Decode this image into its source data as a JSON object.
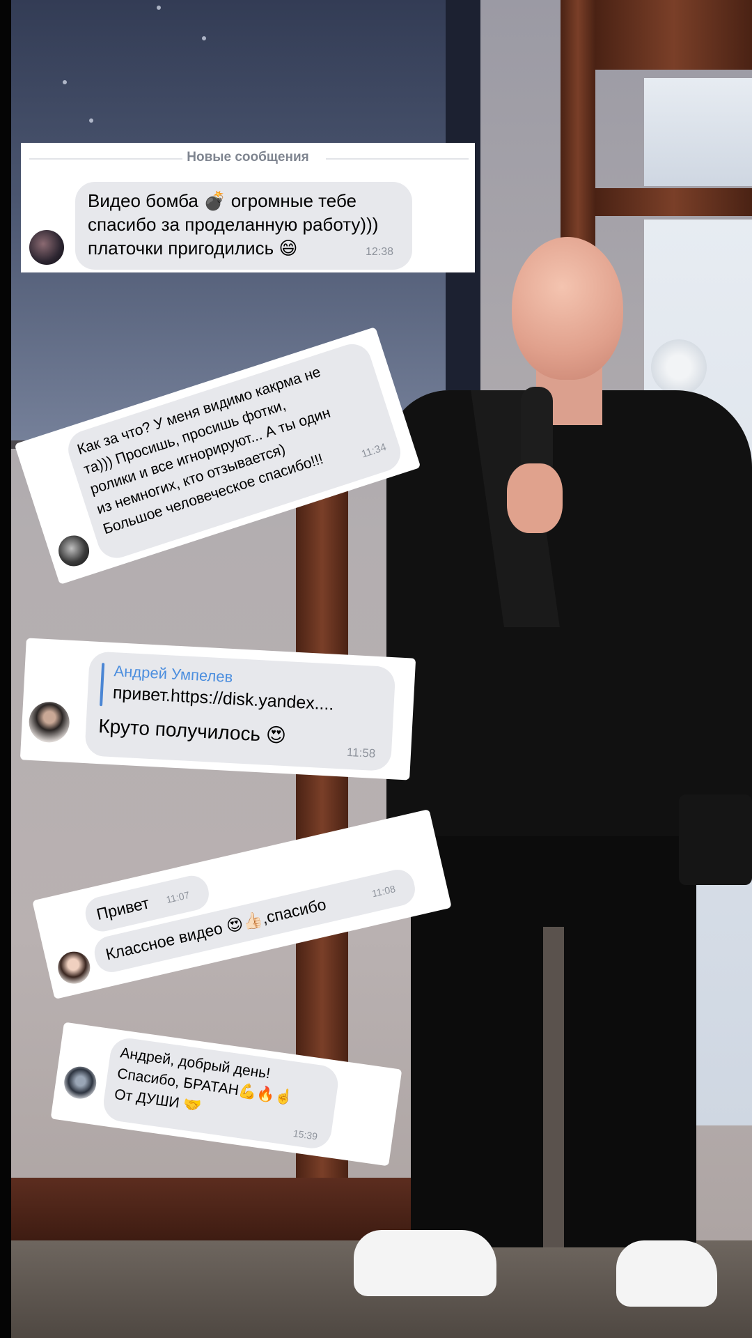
{
  "new_messages_divider": "Новые сообщения",
  "messages": [
    {
      "text": "Видео бомба 💣 огромные тебе\nспасибо за проделанную работу)))\nплаточки пригодились 😄",
      "time": "12:38"
    },
    {
      "text": "Как за что? У меня видимо какрма не\nта))) Просишь, просишь фотки,\nролики и все игнорируют... А ты один\nиз немногих, кто отзывается)\nБольшое человеческое спасибо!!!",
      "time": "11:34"
    },
    {
      "quote_author": "Андрей Умпелев",
      "quote_text": "привет.https://disk.yandex....",
      "text": "Круто получилось 😍",
      "time": "11:58"
    },
    {
      "lines": [
        {
          "text": "Привет",
          "time": "11:07"
        },
        {
          "text": "Классное видео 😍👍🏻,спасибо",
          "time": "11:08"
        }
      ]
    },
    {
      "text": "Андрей, добрый день!\nСпасибо, БРАТАН💪🔥☝️\nОт ДУШИ 🤝",
      "time": "15:39"
    }
  ],
  "colors": {
    "bubble": "#e7e8ec",
    "quote_accent": "#4b86d4",
    "time": "#8e939c"
  }
}
